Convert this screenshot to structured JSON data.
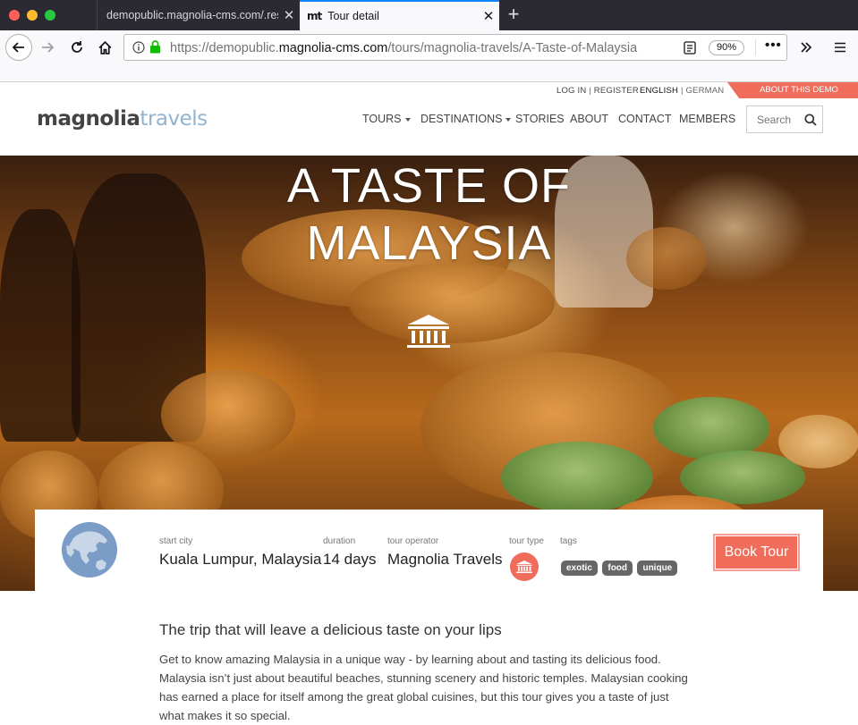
{
  "browser": {
    "tabs": [
      {
        "title": "demopublic.magnolia-cms.com/.res",
        "active": false
      },
      {
        "title": "Tour detail",
        "active": true,
        "favicon": "mt"
      }
    ],
    "url_prefix": "https://demopublic.",
    "url_domain": "magnolia-cms.com",
    "url_path": "/tours/magnolia-travels/A-Taste-of-Malaysia",
    "zoom": "90%"
  },
  "site": {
    "util": {
      "login": "LOG IN",
      "register": "REGISTER",
      "english": "ENGLISH",
      "german": "GERMAN",
      "about_demo": "ABOUT THIS DEMO"
    },
    "logo": {
      "part1": "magnolia",
      "part2": "travels"
    },
    "nav": [
      "TOURS",
      "DESTINATIONS",
      "STORIES",
      "ABOUT",
      "CONTACT",
      "MEMBERS"
    ],
    "search_placeholder": "Search"
  },
  "hero": {
    "title_line1": "A TASTE OF",
    "title_line2": "MALAYSIA"
  },
  "tour": {
    "start_city_label": "start city",
    "start_city": "Kuala Lumpur, Malaysia",
    "duration_label": "duration",
    "duration": "14 days",
    "operator_label": "tour operator",
    "operator": "Magnolia Travels",
    "type_label": "tour type",
    "tags_label": "tags",
    "tags": [
      "exotic",
      "food",
      "unique"
    ],
    "book_label": "Book Tour"
  },
  "content": {
    "heading": "The trip that will leave a delicious taste on your lips",
    "paragraph": "Get to know amazing Malaysia in a unique way - by learning about and tasting its delicious food. Malaysia isn’t just about beautiful beaches, stunning scenery and historic temples. Malaysian cooking has earned a place for itself among the great global cuisines, but this tour gives you a taste of just what makes it so special."
  },
  "colors": {
    "accent": "#f06c5b",
    "tag_bg": "#666666",
    "logo_blue": "#8fb3d1",
    "tab_bar": "#2b2a33"
  }
}
